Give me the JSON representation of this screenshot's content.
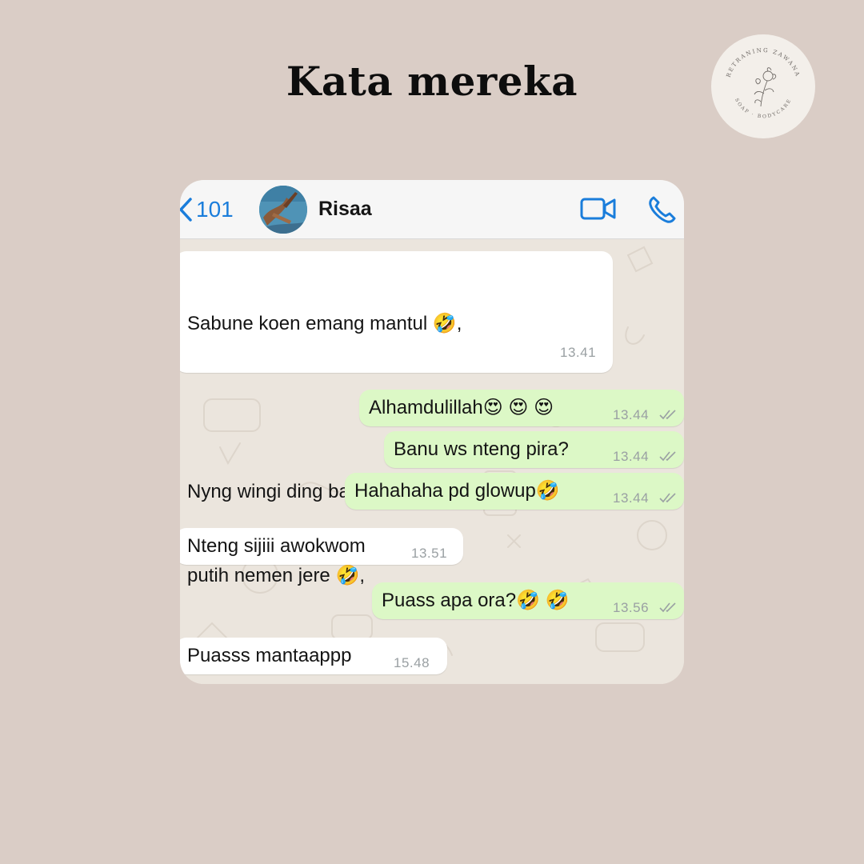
{
  "page": {
    "title": "Kata mereka",
    "background": "#dacdc6"
  },
  "logo": {
    "text_top": "RETRANING ZAWANA",
    "text_bottom": "SOAP · BODYCARE",
    "icon": "flower-sketch-icon"
  },
  "chat": {
    "header": {
      "back_count": "101",
      "contact_name": "Risaa",
      "accent_color": "#1a7ddb",
      "icons": [
        "chevron-left-icon",
        "video-call-icon",
        "phone-icon"
      ]
    },
    "messages": [
      {
        "direction": "in",
        "lines": [
          "Sabune koen emang mantul 🤣,",
          "",
          "Nyng wingi ding batire di omongi tangane",
          "putih nemen jere 🤣,"
        ],
        "time": "13.41"
      },
      {
        "direction": "out",
        "lines": [
          "Alhamdulillah😍 😍 😍"
        ],
        "time": "13.44",
        "read": true
      },
      {
        "direction": "out",
        "lines": [
          "Banu ws nteng pira?"
        ],
        "time": "13.44",
        "read": true
      },
      {
        "direction": "out",
        "lines": [
          "Hahahaha pd glowup🤣"
        ],
        "time": "13.44",
        "read": true
      },
      {
        "direction": "in",
        "lines": [
          "Nteng sijiii awokwom"
        ],
        "time": "13.51"
      },
      {
        "direction": "out",
        "lines": [
          "Puass apa ora?🤣 🤣"
        ],
        "time": "13.56",
        "read": true
      },
      {
        "direction": "in",
        "lines": [
          "Puasss mantaappp"
        ],
        "time": "15.48"
      }
    ],
    "colors": {
      "incoming_bubble": "#ffffff",
      "outgoing_bubble": "#dcf8c6",
      "wallpaper": "#ebe5dd"
    }
  }
}
